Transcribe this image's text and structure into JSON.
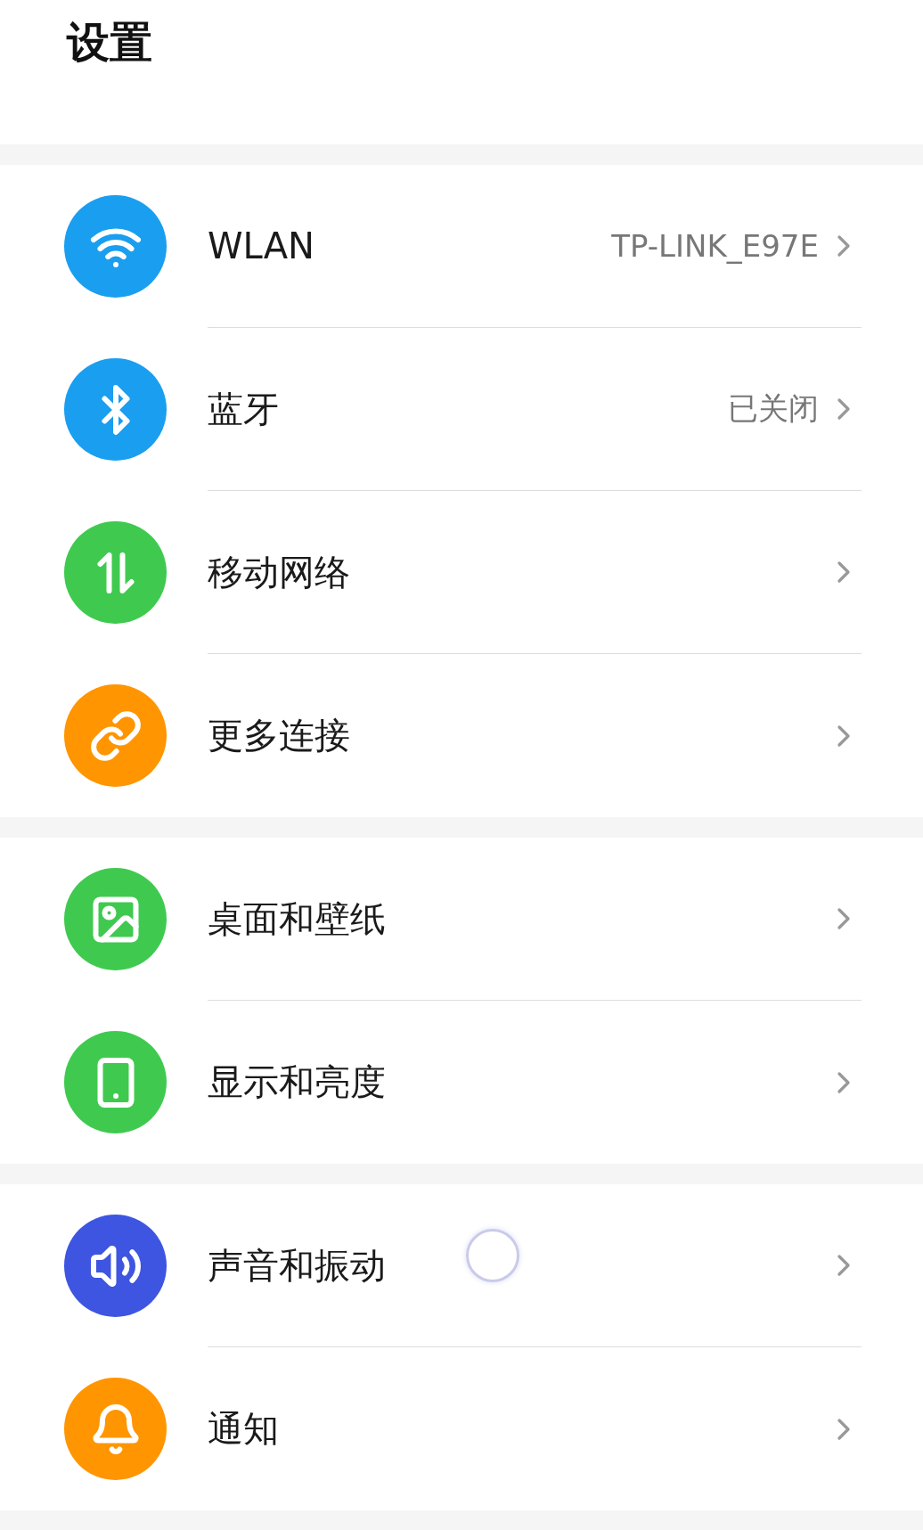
{
  "title": "设置",
  "sections": [
    {
      "items": [
        {
          "kind": "wifi",
          "color": "#1a9ef0",
          "label": "WLAN",
          "value": "TP-LINK_E97E"
        },
        {
          "kind": "bluetooth",
          "color": "#1a9ef0",
          "label": "蓝牙",
          "value": "已关闭"
        },
        {
          "kind": "mobile-data",
          "color": "#3fca4f",
          "label": "移动网络"
        },
        {
          "kind": "link",
          "color": "#ff9500",
          "label": "更多连接"
        }
      ]
    },
    {
      "items": [
        {
          "kind": "wallpaper",
          "color": "#3fca4f",
          "label": "桌面和壁纸"
        },
        {
          "kind": "display",
          "color": "#3fca4f",
          "label": "显示和亮度"
        }
      ]
    },
    {
      "items": [
        {
          "kind": "sound",
          "color": "#3d55e0",
          "label": "声音和振动"
        },
        {
          "kind": "bell",
          "color": "#ff9500",
          "label": "通知"
        }
      ]
    }
  ]
}
